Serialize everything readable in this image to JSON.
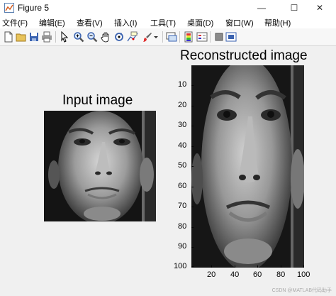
{
  "window": {
    "title": "Figure 5",
    "minimize_glyph": "—",
    "maximize_glyph": "☐",
    "close_glyph": "✕"
  },
  "menu": [
    "文件(F)",
    "编辑(E)",
    "查看(V)",
    "插入(I)",
    "工具(T)",
    "桌面(D)",
    "窗口(W)",
    "帮助(H)"
  ],
  "toolbar_icons": [
    "new-figure-icon",
    "open-icon",
    "save-icon",
    "print-icon",
    "pointer-icon",
    "zoom-in-icon",
    "zoom-out-icon",
    "pan-icon",
    "rotate-icon",
    "data-cursor-icon",
    "brush-icon",
    "brush-dropdown-icon",
    "link-plot-icon",
    "colorbar-icon",
    "legend-icon",
    "hide-plot-tools-icon",
    "show-plot-tools-icon"
  ],
  "figure": {
    "input_title": "Input image",
    "reconstructed_title": "Reconstructed image",
    "y_ticks": [
      "10",
      "20",
      "30",
      "40",
      "50",
      "60",
      "70",
      "80",
      "90",
      "100"
    ],
    "x_ticks": [
      "20",
      "40",
      "60",
      "80",
      "100"
    ],
    "y_range": [
      0.5,
      100.5
    ],
    "x_range": [
      0.5,
      110.5
    ],
    "colormap": "gray"
  },
  "watermark": "CSDN @MATLAB代码助手"
}
